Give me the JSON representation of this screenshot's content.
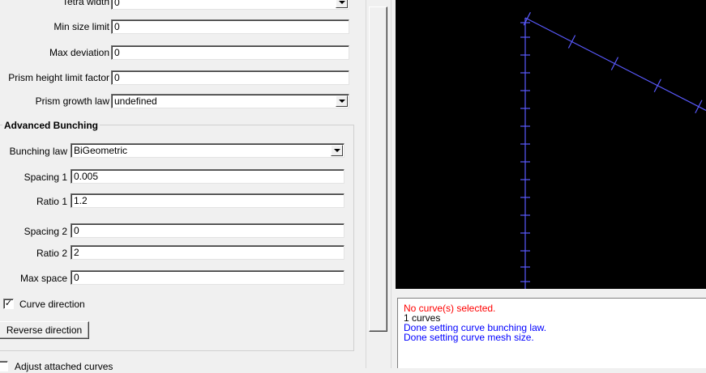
{
  "mesh": {
    "tetra_width": {
      "label": "Tetra width",
      "value": "0"
    },
    "min_size_limit": {
      "label": "Min size limit",
      "value": "0"
    },
    "max_deviation": {
      "label": "Max deviation",
      "value": "0"
    },
    "prism_height_limit_factor": {
      "label": "Prism height limit factor",
      "value": "0"
    },
    "prism_growth_law": {
      "label": "Prism growth law",
      "value": "undefined"
    }
  },
  "advanced_bunching": {
    "title": "Advanced Bunching",
    "bunching_law": {
      "label": "Bunching law",
      "value": "BiGeometric"
    },
    "spacing1": {
      "label": "Spacing 1",
      "value": "0.005"
    },
    "ratio1": {
      "label": "Ratio 1",
      "value": "1.2"
    },
    "spacing2": {
      "label": "Spacing 2",
      "value": "0"
    },
    "ratio2": {
      "label": "Ratio 2",
      "value": "2"
    },
    "max_space": {
      "label": "Max space",
      "value": "0"
    },
    "curve_direction": {
      "label": "Curve direction",
      "checked": true,
      "mark": "✓"
    },
    "reverse_direction": {
      "label": "Reverse direction"
    }
  },
  "adjust_attached": {
    "label": "Adjust attached curves",
    "checked": false
  },
  "log": {
    "lines": [
      {
        "text": "No curve(s) selected.",
        "color": "#ff0000"
      },
      {
        "text": "1 curves",
        "color": "#000000"
      },
      {
        "text": "Done setting curve bunching law.",
        "color": "#0000ff"
      },
      {
        "text": "Done setting curve mesh size.",
        "color": "#0000ff"
      }
    ]
  },
  "colors": {
    "curve": "#5a5aff",
    "viewport_bg": "#000000",
    "panel_bg": "#f0f0f0"
  }
}
